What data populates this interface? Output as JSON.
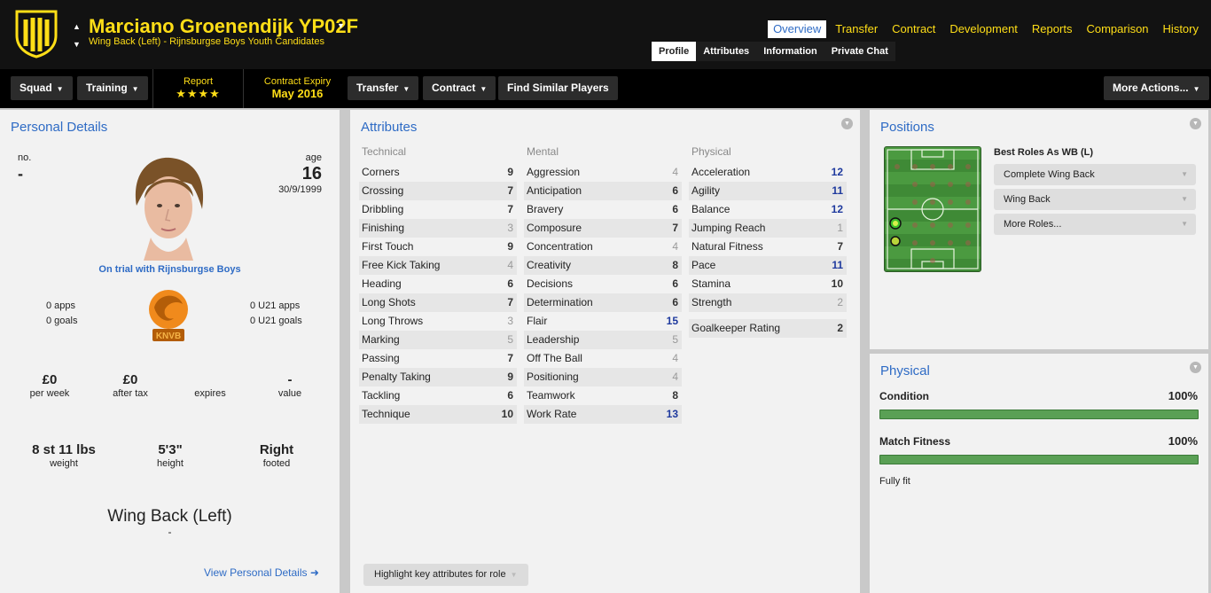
{
  "header": {
    "player_name": "Marciano Groenendijk YP02F",
    "player_sub": "Wing Back (Left) - Rijnsburgse Boys Youth Candidates",
    "top_tabs": [
      "Overview",
      "Transfer",
      "Contract",
      "Development",
      "Reports",
      "Comparison",
      "History"
    ],
    "active_top_tab": "Overview",
    "sub_tabs": [
      "Profile",
      "Attributes",
      "Information",
      "Private Chat"
    ],
    "active_sub_tab": "Profile",
    "accent_color": "#ffde17",
    "link_color": "#2e6bc5"
  },
  "toolbar": {
    "squad": "Squad",
    "training": "Training",
    "report_label": "Report",
    "report_stars": "★★★★",
    "contract_label": "Contract Expiry",
    "contract_value": "May 2016",
    "transfer": "Transfer",
    "contract": "Contract",
    "find_similar": "Find Similar Players",
    "more_actions": "More Actions..."
  },
  "personal": {
    "title": "Personal Details",
    "no_label": "no.",
    "no_value": "-",
    "age_label": "age",
    "age_value": "16",
    "dob": "30/9/1999",
    "trial": "On trial with Rijnsburgse Boys",
    "apps": "0 apps",
    "goals": "0 goals",
    "u21_apps": "0 U21 apps",
    "u21_goals": "0 U21 goals",
    "wage": "£0",
    "wage_label": "per week",
    "after_tax": "£0",
    "after_tax_label": "after tax",
    "expires_label": "expires",
    "value": "-",
    "value_label": "value",
    "weight": "8 st 11 lbs",
    "weight_label": "weight",
    "height": "5'3\"",
    "height_label": "height",
    "foot": "Right",
    "foot_label": "footed",
    "position": "Wing Back (Left)",
    "position_sub": "-",
    "link": "View Personal Details ➜",
    "badge_text": "KNVB"
  },
  "attributes": {
    "title": "Attributes",
    "technical_label": "Technical",
    "mental_label": "Mental",
    "physical_label": "Physical",
    "technical": [
      {
        "name": "Corners",
        "value": "9"
      },
      {
        "name": "Crossing",
        "value": "7"
      },
      {
        "name": "Dribbling",
        "value": "7"
      },
      {
        "name": "Finishing",
        "value": "3"
      },
      {
        "name": "First Touch",
        "value": "9"
      },
      {
        "name": "Free Kick Taking",
        "value": "4"
      },
      {
        "name": "Heading",
        "value": "6"
      },
      {
        "name": "Long Shots",
        "value": "7"
      },
      {
        "name": "Long Throws",
        "value": "3"
      },
      {
        "name": "Marking",
        "value": "5"
      },
      {
        "name": "Passing",
        "value": "7"
      },
      {
        "name": "Penalty Taking",
        "value": "9"
      },
      {
        "name": "Tackling",
        "value": "6"
      },
      {
        "name": "Technique",
        "value": "10"
      }
    ],
    "mental": [
      {
        "name": "Aggression",
        "value": "4"
      },
      {
        "name": "Anticipation",
        "value": "6"
      },
      {
        "name": "Bravery",
        "value": "6"
      },
      {
        "name": "Composure",
        "value": "7"
      },
      {
        "name": "Concentration",
        "value": "4"
      },
      {
        "name": "Creativity",
        "value": "8"
      },
      {
        "name": "Decisions",
        "value": "6"
      },
      {
        "name": "Determination",
        "value": "6"
      },
      {
        "name": "Flair",
        "value": "15"
      },
      {
        "name": "Leadership",
        "value": "5"
      },
      {
        "name": "Off The Ball",
        "value": "4"
      },
      {
        "name": "Positioning",
        "value": "4"
      },
      {
        "name": "Teamwork",
        "value": "8"
      },
      {
        "name": "Work Rate",
        "value": "13"
      }
    ],
    "physical": [
      {
        "name": "Acceleration",
        "value": "12"
      },
      {
        "name": "Agility",
        "value": "11"
      },
      {
        "name": "Balance",
        "value": "12"
      },
      {
        "name": "Jumping Reach",
        "value": "1"
      },
      {
        "name": "Natural Fitness",
        "value": "7"
      },
      {
        "name": "Pace",
        "value": "11"
      },
      {
        "name": "Stamina",
        "value": "10"
      },
      {
        "name": "Strength",
        "value": "2"
      }
    ],
    "gk_label": "Goalkeeper Rating",
    "gk_value": "2",
    "highlight": "Highlight key attributes for role"
  },
  "positions": {
    "title": "Positions",
    "roles_title": "Best Roles As WB (L)",
    "roles": [
      "Complete Wing Back",
      "Wing Back",
      "More Roles..."
    ]
  },
  "physical": {
    "title": "Physical",
    "condition_label": "Condition",
    "condition_value": "100%",
    "condition_level": 1.0,
    "fitness_label": "Match Fitness",
    "fitness_value": "100%",
    "fitness_level": 1.0,
    "status": "Fully fit",
    "bar_color": "#5aa055"
  }
}
